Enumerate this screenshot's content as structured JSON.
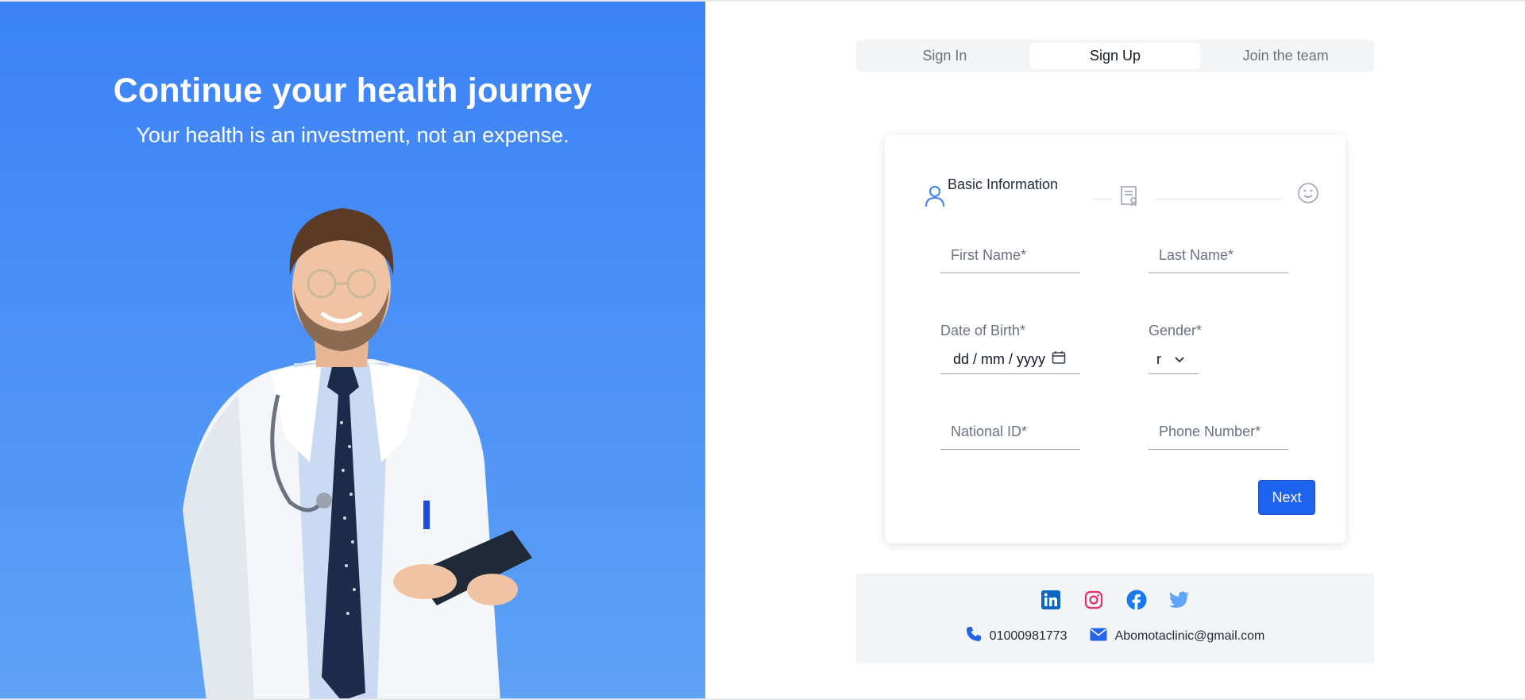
{
  "hero": {
    "title": "Continue your health journey",
    "subtitle": "Your health is an investment, not an expense.",
    "image": "doctor-with-tablet"
  },
  "tabs": [
    {
      "label": "Sign In",
      "active": false
    },
    {
      "label": "Sign Up",
      "active": true
    },
    {
      "label": "Join the team",
      "active": false
    }
  ],
  "steps": {
    "current_label": "Basic Information",
    "icons": [
      "user-icon",
      "certificate-icon",
      "smile-icon"
    ]
  },
  "form": {
    "first_name_placeholder": "First Name*",
    "last_name_placeholder": "Last Name*",
    "dob_label": "Date of Birth*",
    "dob_value": "dd / mm / yyyy",
    "gender_label": "Gender*",
    "gender_value": "r",
    "national_id_placeholder": "National ID*",
    "phone_placeholder": "Phone Number*",
    "next_label": "Next"
  },
  "footer": {
    "social_icons": [
      "linkedin-icon",
      "instagram-icon",
      "facebook-icon",
      "twitter-icon"
    ],
    "phone": "01000981773",
    "email": "Abomotaclinic@gmail.com"
  },
  "colors": {
    "hero_gradient_top": "#3b82f6",
    "hero_gradient_bottom": "#5ea1f6",
    "primary_button": "#1d63ed",
    "linkedin": "#0a66c2",
    "instagram": "#e1306c",
    "facebook": "#1877f2",
    "twitter": "#60a5fa"
  }
}
